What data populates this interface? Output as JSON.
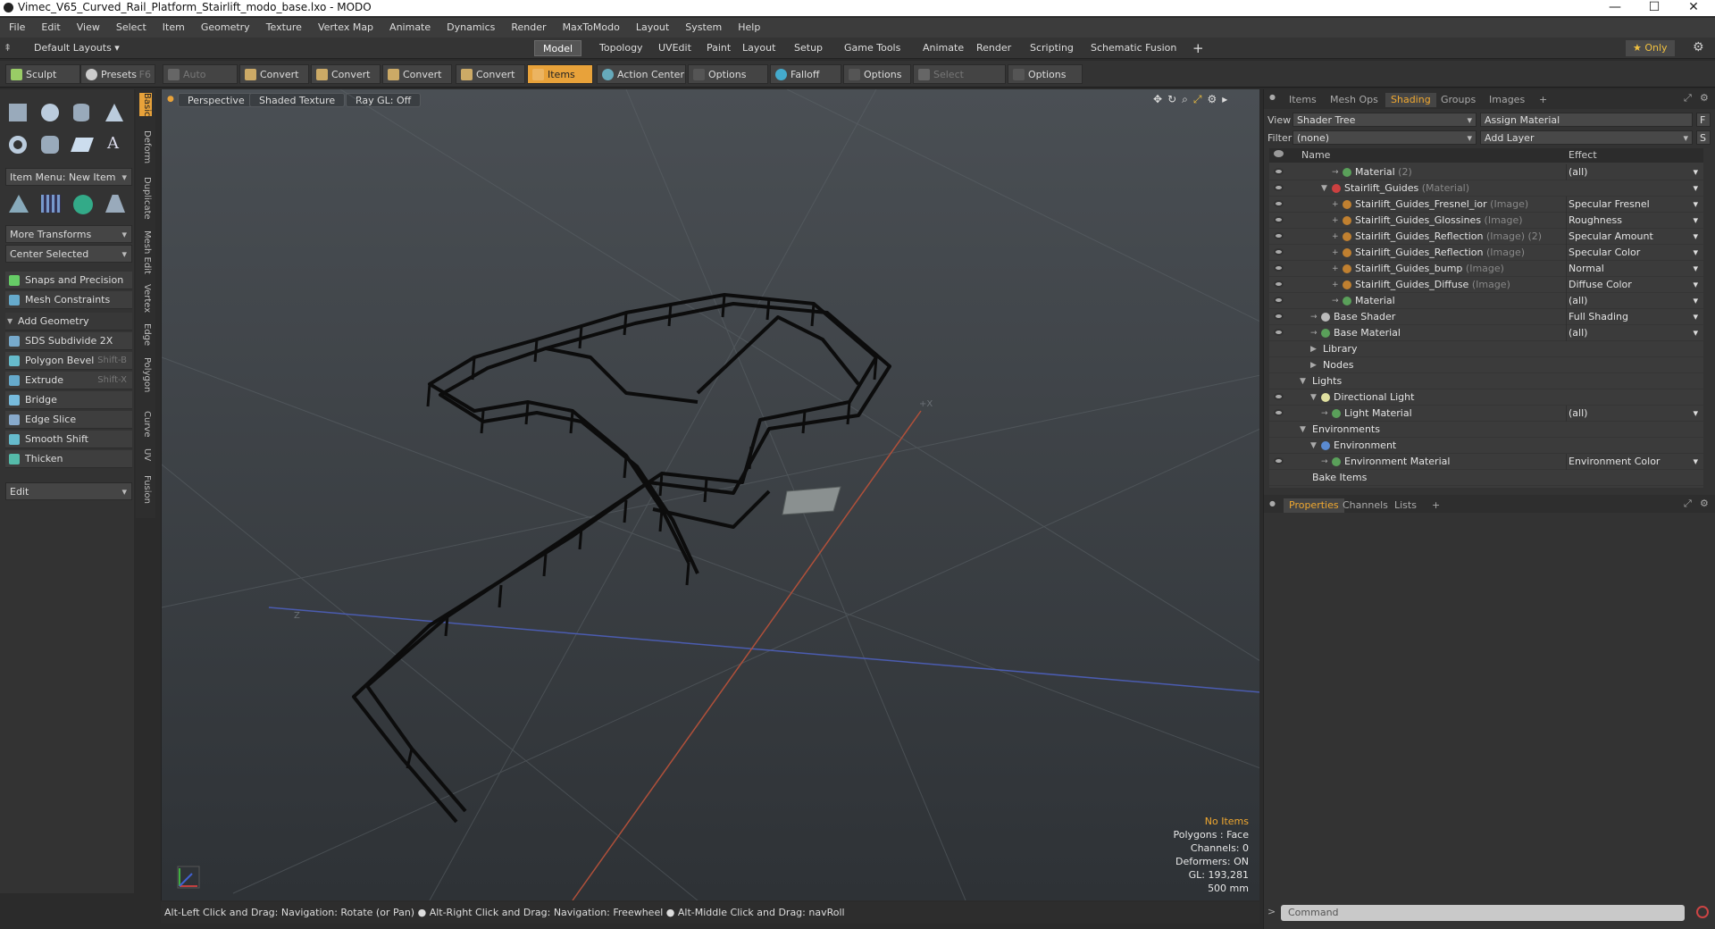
{
  "window": {
    "title": "Vimec_V65_Curved_Rail_Platform_Stairlift_modo_base.lxo - MODO",
    "minimize": "—",
    "maximize": "☐",
    "close": "✕"
  },
  "menu": [
    "File",
    "Edit",
    "View",
    "Select",
    "Item",
    "Geometry",
    "Texture",
    "Vertex Map",
    "Animate",
    "Dynamics",
    "Render",
    "MaxToModo",
    "Layout",
    "System",
    "Help"
  ],
  "layoutbar": {
    "layouts_label": "Default Layouts ▾",
    "tabs": [
      "Model",
      "Topology",
      "UVEdit",
      "Paint",
      "Layout",
      "Setup",
      "Game Tools",
      "Animate",
      "Render",
      "Scripting",
      "Schematic Fusion"
    ],
    "active_tab": "Model",
    "plus": "+",
    "only_label": "★  Only"
  },
  "toolbar": {
    "sculpt": "Sculpt",
    "presets": "Presets",
    "presets_key": "F6",
    "auto_select": "Auto Select",
    "convert1": "Convert",
    "convert2": "Convert",
    "convert3": "Convert",
    "convert4": "Convert",
    "items": "Items",
    "action_center": "Action Center",
    "options1": "Options",
    "falloff": "Falloff",
    "options2": "Options",
    "select_through": "Select Through",
    "options3": "Options"
  },
  "leftpanel": {
    "item_menu": "Item Menu: New Item",
    "more_transforms": "More Transforms",
    "center_selected": "Center Selected",
    "snaps": "Snaps and Precision",
    "mesh_constraints": "Mesh Constraints",
    "add_geometry": "Add Geometry",
    "tools": [
      {
        "label": "SDS Subdivide 2X",
        "key": ""
      },
      {
        "label": "Polygon Bevel",
        "key": "Shift-B"
      },
      {
        "label": "Extrude",
        "key": "Shift-X"
      },
      {
        "label": "Bridge",
        "key": ""
      },
      {
        "label": "Edge Slice",
        "key": ""
      },
      {
        "label": "Smooth Shift",
        "key": ""
      },
      {
        "label": "Thicken",
        "key": ""
      }
    ],
    "edit_dropdown": "Edit",
    "vertical_tabs": [
      "Basic",
      "Deform",
      "Duplicate",
      "Mesh Edit",
      "Vertex",
      "Edge",
      "Polygon",
      "Curve",
      "UV",
      "Fusion"
    ]
  },
  "viewport": {
    "perspective": "Perspective",
    "shaded": "Shaded Texture",
    "raygl": "Ray GL: Off",
    "info": {
      "no_items": "No Items",
      "polygons": "Polygons : Face",
      "channels": "Channels: 0",
      "deformers": "Deformers: ON",
      "gl": "GL: 193,281",
      "scale": "500 mm"
    },
    "axis_x": "+X",
    "axis_z": "Z"
  },
  "status": "Alt-Left Click and Drag: Navigation: Rotate (or Pan) ●  Alt-Right Click and Drag: Navigation: Freewheel ●  Alt-Middle Click and Drag: navRoll",
  "rightpanel": {
    "tabs": [
      "Items",
      "Mesh Ops",
      "Shading",
      "Groups",
      "Images",
      "+"
    ],
    "active_tab": "Shading",
    "view_label": "View",
    "view_value": "Shader Tree",
    "assign_material": "Assign Material",
    "f_btn": "F",
    "filter_label": "Filter",
    "filter_value": "(none)",
    "add_layer": "Add Layer",
    "s_btn": "S",
    "col_name": "Name",
    "col_effect": "Effect",
    "rows": [
      {
        "indent": 4,
        "name": "Material",
        "sub": " (2)",
        "effect": "(all)",
        "eye": true,
        "color": "#5aa05a",
        "dd": true,
        "twist": "→"
      },
      {
        "indent": 3,
        "name": "Stairlift_Guides",
        "sub": " (Material)",
        "effect": "",
        "eye": true,
        "color": "#cc4040",
        "dd": true,
        "twist": "▼"
      },
      {
        "indent": 4,
        "name": "Stairlift_Guides_Fresnel_ior",
        "sub": " (Image)",
        "effect": "Specular Fresnel",
        "eye": true,
        "color": "#c08030",
        "dd": true,
        "twist": "+"
      },
      {
        "indent": 4,
        "name": "Stairlift_Guides_Glossines",
        "sub": " (Image)",
        "effect": "Roughness",
        "eye": true,
        "color": "#c08030",
        "dd": true,
        "twist": "+"
      },
      {
        "indent": 4,
        "name": "Stairlift_Guides_Reflection",
        "sub": " (Image) (2)",
        "effect": "Specular Amount",
        "eye": true,
        "color": "#c08030",
        "dd": true,
        "twist": "+"
      },
      {
        "indent": 4,
        "name": "Stairlift_Guides_Reflection",
        "sub": " (Image)",
        "effect": "Specular Color",
        "eye": true,
        "color": "#c08030",
        "dd": true,
        "twist": "+"
      },
      {
        "indent": 4,
        "name": "Stairlift_Guides_bump",
        "sub": " (Image)",
        "effect": "Normal",
        "eye": true,
        "color": "#c08030",
        "dd": true,
        "twist": "+"
      },
      {
        "indent": 4,
        "name": "Stairlift_Guides_Diffuse",
        "sub": " (Image)",
        "effect": "Diffuse Color",
        "eye": true,
        "color": "#c08030",
        "dd": true,
        "twist": "+"
      },
      {
        "indent": 4,
        "name": "Material",
        "sub": "",
        "effect": "(all)",
        "eye": true,
        "color": "#5aa05a",
        "dd": true,
        "twist": "→"
      },
      {
        "indent": 2,
        "name": "Base Shader",
        "sub": "",
        "effect": "Full Shading",
        "eye": true,
        "color": "#bbbbbb",
        "dd": true,
        "twist": "→"
      },
      {
        "indent": 2,
        "name": "Base Material",
        "sub": "",
        "effect": "(all)",
        "eye": true,
        "color": "#5aa05a",
        "dd": true,
        "twist": "→"
      },
      {
        "indent": 2,
        "name": "Library",
        "sub": "",
        "effect": "",
        "eye": false,
        "color": "",
        "dd": false,
        "twist": "▶"
      },
      {
        "indent": 2,
        "name": "Nodes",
        "sub": "",
        "effect": "",
        "eye": false,
        "color": "",
        "dd": false,
        "twist": "▶"
      },
      {
        "indent": 1,
        "name": "Lights",
        "sub": "",
        "effect": "",
        "eye": false,
        "color": "",
        "dd": false,
        "twist": "▼"
      },
      {
        "indent": 2,
        "name": "Directional Light",
        "sub": "",
        "effect": "",
        "eye": true,
        "color": "#e0e0a0",
        "dd": false,
        "twist": "▼"
      },
      {
        "indent": 3,
        "name": "Light Material",
        "sub": "",
        "effect": "(all)",
        "eye": true,
        "color": "#5aa05a",
        "dd": true,
        "twist": "→"
      },
      {
        "indent": 1,
        "name": "Environments",
        "sub": "",
        "effect": "",
        "eye": false,
        "color": "",
        "dd": false,
        "twist": "▼"
      },
      {
        "indent": 2,
        "name": "Environment",
        "sub": "",
        "effect": "",
        "eye": false,
        "color": "#5a8ad0",
        "dd": false,
        "twist": "▼"
      },
      {
        "indent": 3,
        "name": "Environment Material",
        "sub": "",
        "effect": "Environment Color",
        "eye": true,
        "color": "#5aa05a",
        "dd": true,
        "twist": "→"
      },
      {
        "indent": 1,
        "name": "Bake Items",
        "sub": "",
        "effect": "",
        "eye": false,
        "color": "",
        "dd": false,
        "twist": ""
      }
    ],
    "props_tabs": [
      "Properties",
      "Channels",
      "Lists",
      "+"
    ],
    "command_placeholder": "Command"
  }
}
